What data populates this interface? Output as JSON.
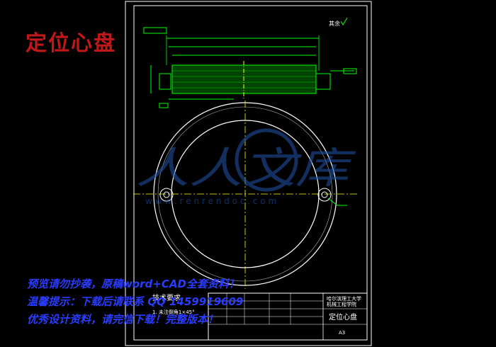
{
  "overlay": {
    "title": "定位心盘",
    "promo_lines": [
      "预览请勿抄袭，原稿word+CAD全套资料！",
      "温馨提示：下载后请联系 QQ 1459919609",
      "优秀设计资料，请完信下载！完整版本！"
    ]
  },
  "watermark": {
    "brand": "人人文库",
    "url": "w w w . r e n r e n d o c . c o m"
  },
  "drawing": {
    "roughness_mark": "其余",
    "tech_title": "技术要求",
    "tech_note": "1. 未注倒角1×45°",
    "title_block": {
      "school_line1": "哈尔滨理工大学",
      "school_line2": "机械工程学院",
      "part_name": "定位心盘",
      "sheet_size": "A3"
    }
  },
  "colors": {
    "frame": "#ffffff",
    "geometry": "#00ff00",
    "centerline": "#ffff00",
    "dimension": "#00ff40",
    "watermark": "#1e4fa0",
    "overlay_title": "#c01818",
    "promo": "#2a3cff"
  }
}
